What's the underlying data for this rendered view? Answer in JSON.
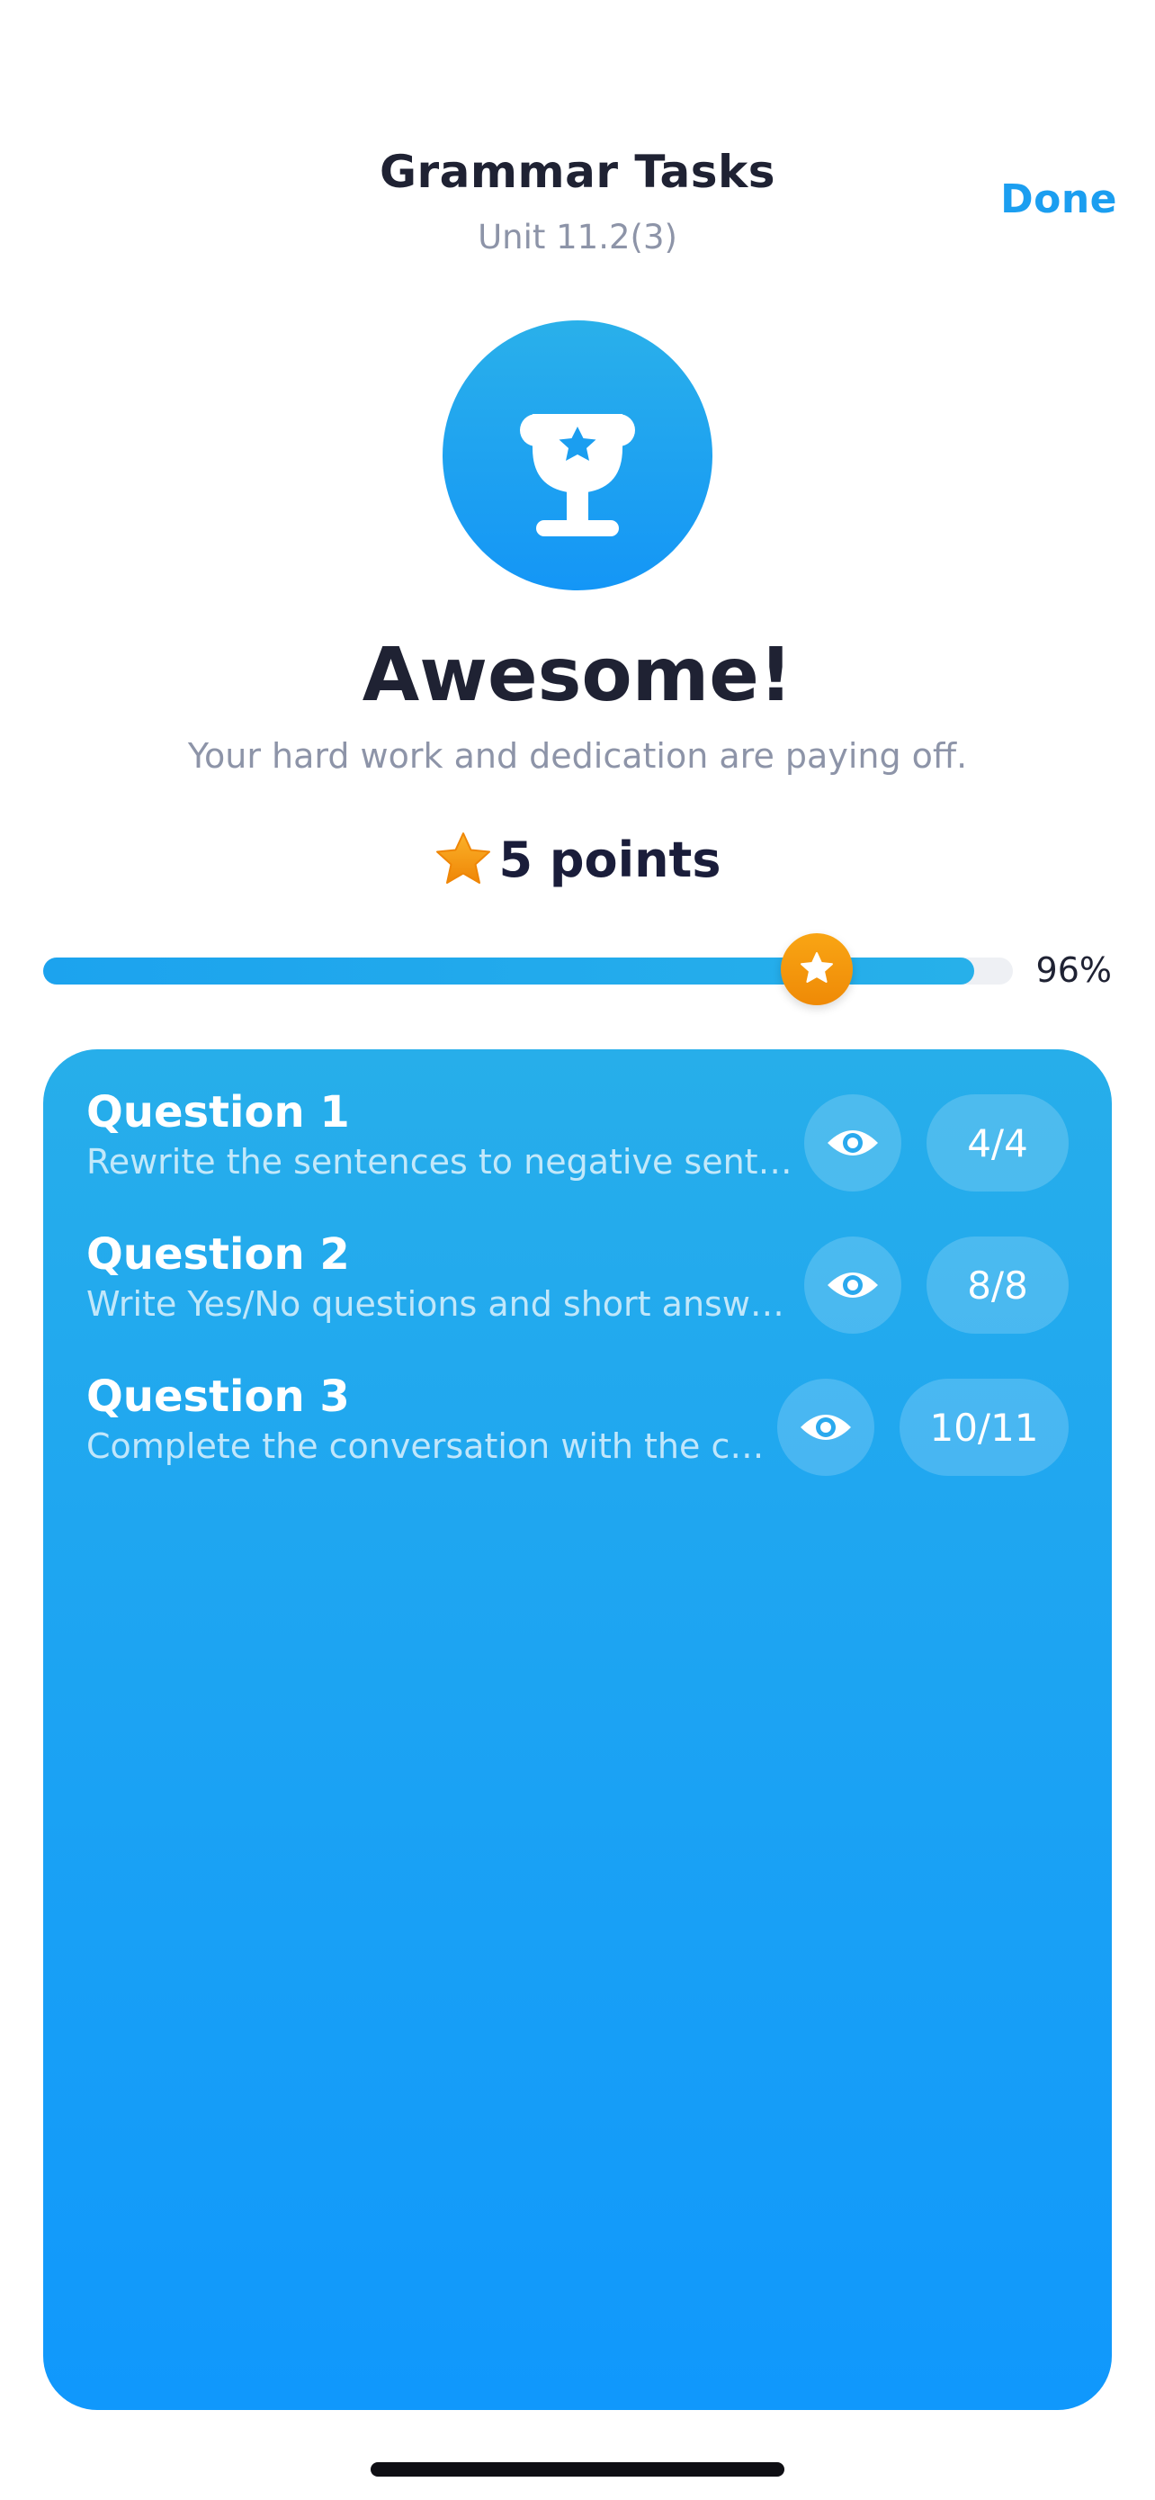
{
  "header": {
    "title": "Grammar Tasks",
    "subtitle": "Unit 11.2(3)",
    "done_label": "Done"
  },
  "result": {
    "icon": "trophy-icon",
    "headline": "Awesome!",
    "tagline": "Your hard work and dedication are paying off.",
    "points_icon": "star-icon",
    "points_text": "5 points"
  },
  "progress": {
    "value": 0.96,
    "label": "96%",
    "knob_icon": "star-icon"
  },
  "questions": [
    {
      "title": "Question 1",
      "description": "Rewrite the sentences to negative sent…",
      "view_icon": "eye-icon",
      "score": "4/4"
    },
    {
      "title": "Question 2",
      "description": "Write Yes/No questions and short answ…",
      "view_icon": "eye-icon",
      "score": "8/8"
    },
    {
      "title": "Question 3",
      "description": "Complete the conversation with the c…",
      "view_icon": "eye-icon",
      "score": "10/11"
    }
  ],
  "colors": {
    "accent": "#1b9ef0",
    "card_top": "#27aeea",
    "card_bottom": "#1098fc",
    "star": "#f39a0c",
    "heading": "#1f2233",
    "muted": "#8d94a8"
  }
}
